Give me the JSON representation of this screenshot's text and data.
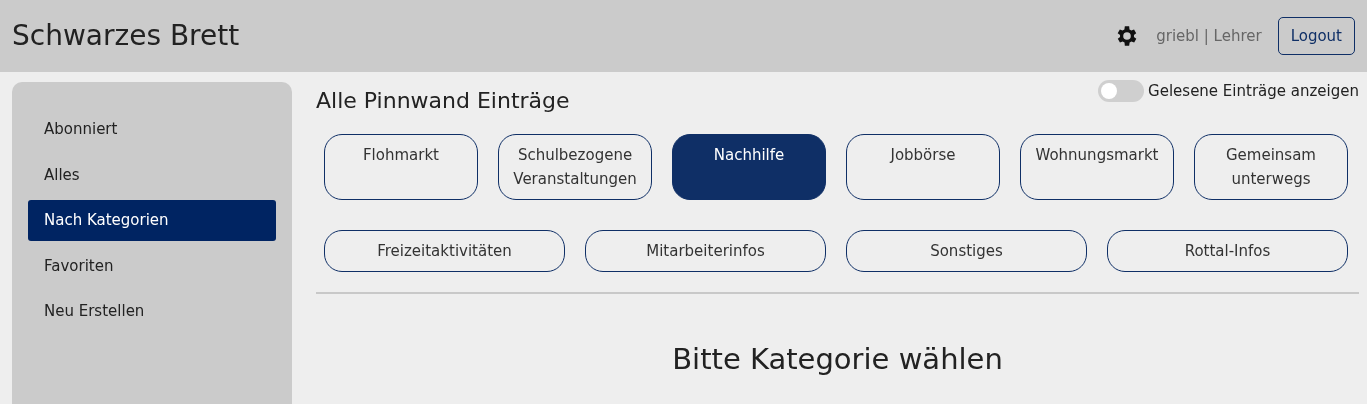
{
  "header": {
    "title": "Schwarzes Brett",
    "user": "griebl | Lehrer",
    "logout": "Logout"
  },
  "sidebar": {
    "items": [
      {
        "label": "Abonniert",
        "selected": false
      },
      {
        "label": "Alles",
        "selected": false
      },
      {
        "label": "Nach Kategorien",
        "selected": true
      },
      {
        "label": "Favoriten",
        "selected": false
      },
      {
        "label": "Neu Erstellen",
        "selected": false
      }
    ]
  },
  "main": {
    "heading": "Alle Pinnwand Einträge",
    "toggle": {
      "label": "Gelesene Einträge anzeigen",
      "on": false
    },
    "category_rows": [
      [
        {
          "label": "Flohmarkt",
          "selected": false
        },
        {
          "label": "Schulbezogene Veranstaltungen",
          "selected": false
        },
        {
          "label": "Nachhilfe",
          "selected": true
        },
        {
          "label": "Jobbörse",
          "selected": false
        },
        {
          "label": "Wohnungsmarkt",
          "selected": false
        },
        {
          "label": "Gemeinsam unterwegs",
          "selected": false
        }
      ],
      [
        {
          "label": "Freizeitaktivitäten",
          "selected": false
        },
        {
          "label": "Mitarbeiterinfos",
          "selected": false
        },
        {
          "label": "Sonstiges",
          "selected": false
        },
        {
          "label": "Rottal-Infos",
          "selected": false
        }
      ]
    ],
    "message": "Bitte Kategorie wählen"
  }
}
